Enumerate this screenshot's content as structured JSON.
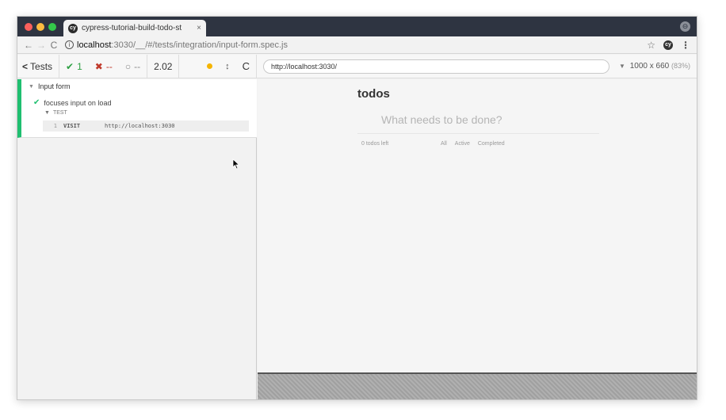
{
  "browser": {
    "tab_title": "cypress-tutorial-build-todo-st",
    "tab_close": "×",
    "tab_favicon": "cy",
    "url_host": "localhost",
    "url_rest": ":3030/__/#/tests/integration/input-form.spec.js",
    "icons": {
      "back": "←",
      "forward": "→",
      "reload": "C",
      "info": "i",
      "star": "☆",
      "menu": "⋮",
      "profile": "⊖"
    }
  },
  "reporter": {
    "tests_label": "Tests",
    "passed_count": "1",
    "failed_count": "--",
    "pending_count": "--",
    "duration": "2.02",
    "suite_title": "Input form",
    "test_title": "focuses input on load",
    "test_section_label": "TEST",
    "commands": [
      {
        "number": "1",
        "name": "VISIT",
        "message": "http://localhost:3030"
      }
    ]
  },
  "aut": {
    "url": "http://localhost:3030/",
    "viewport": "1000 x 660",
    "scale": "(83%)",
    "todo_title": "todos",
    "new_todo_placeholder": "What needs to be done?",
    "todo_count": "0 todos left",
    "filters": [
      "All",
      "Active",
      "Completed"
    ]
  },
  "colors": {
    "passed": "#1fbf70",
    "failed": "#c0392b",
    "running_indicator": "#f5b400"
  }
}
